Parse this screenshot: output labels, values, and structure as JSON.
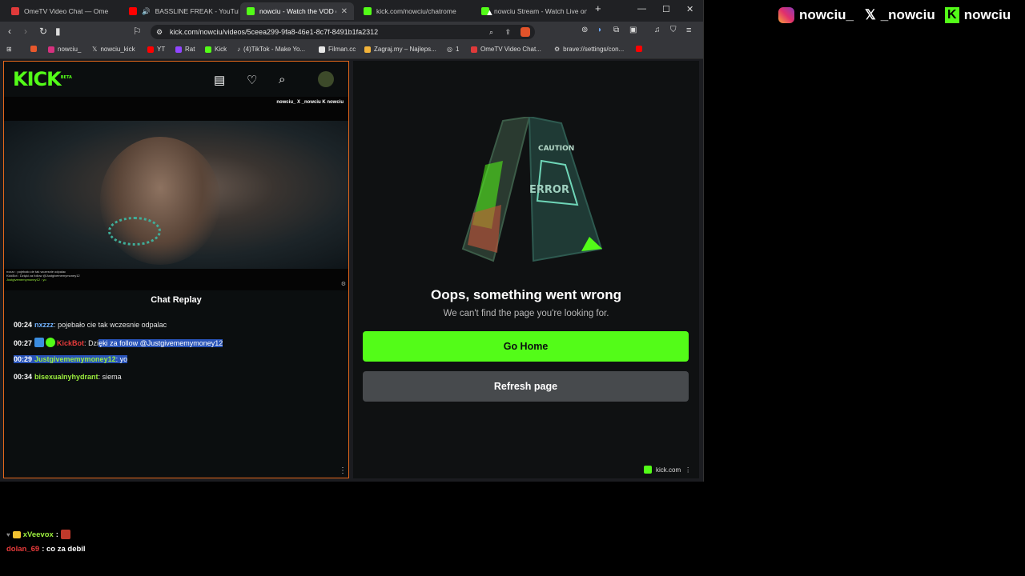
{
  "browser": {
    "tabs": [
      {
        "label": "OmeTV Video Chat — Ome",
        "favicon": "omtv"
      },
      {
        "label": "BASSLINE FREAK - YouTube",
        "favicon": "yt"
      },
      {
        "label": "nowciu - Watch the VOD o",
        "favicon": "kick",
        "active": true
      },
      {
        "label": "kick.com/nowciu/chatrome",
        "favicon": "kick"
      },
      {
        "label": "nowciu Stream - Watch Live on",
        "favicon": "kick"
      }
    ],
    "new_tab": "+",
    "url": "kick.com/nowciu/videos/5ceea299-9fa8-46e1-8c7f-8491b1fa2312",
    "bookmarks": [
      {
        "label": ""
      },
      {
        "label": "nowciu_"
      },
      {
        "label": "nowciu_kick"
      },
      {
        "label": "YT"
      },
      {
        "label": "Rat"
      },
      {
        "label": "Kick"
      },
      {
        "label": "(4)TikTok - Make Yo..."
      },
      {
        "label": "Filman.cc"
      },
      {
        "label": "Zagraj.my – Najleps..."
      },
      {
        "label": "1"
      },
      {
        "label": "OmeTV Video Chat..."
      },
      {
        "label": "brave://settings/con..."
      }
    ]
  },
  "kick": {
    "logo": "KICK",
    "logo_sup": "BETA",
    "video_overlay": "nowciu_  X _nowciu  K nowciu",
    "video_chat_lines": [
      "nxzzz : pojebało cie tak wczesnie odpalac",
      "KickBot : Dzięki za follow @Justgivememymoney12",
      "Justgivememymoney12 : yo"
    ],
    "chat_title": "Chat Replay",
    "messages": [
      {
        "time": "00:24",
        "user": "nxzzz",
        "text": "pojebało cie tak wczesnie odpalac"
      },
      {
        "time": "00:27",
        "user": "KickBot",
        "text_a": "Dzi",
        "text_b": "ęki za follow  @Justgivememymoney12"
      },
      {
        "time": "00:29",
        "user": "Justgivememymoney12",
        "text": "yo"
      },
      {
        "time": "00:34",
        "user": "bisexualnyhydrant",
        "text": "siema"
      }
    ]
  },
  "error": {
    "title": "Oops, something went wrong",
    "subtitle": "We can't find the page you're looking for.",
    "home_button": "Go Home",
    "refresh_button": "Refresh page",
    "sign_text_1": "CAUTION",
    "sign_text_2": "ERROR",
    "chip": "kick.com"
  },
  "overlay": {
    "instagram": "nowciu_",
    "x_handle": "_nowciu",
    "kick_handle": "nowciu"
  },
  "stream_chat": [
    {
      "user": "xVeevox",
      "text": ":"
    },
    {
      "user": "dolan_69",
      "text": ": co za debil"
    }
  ]
}
